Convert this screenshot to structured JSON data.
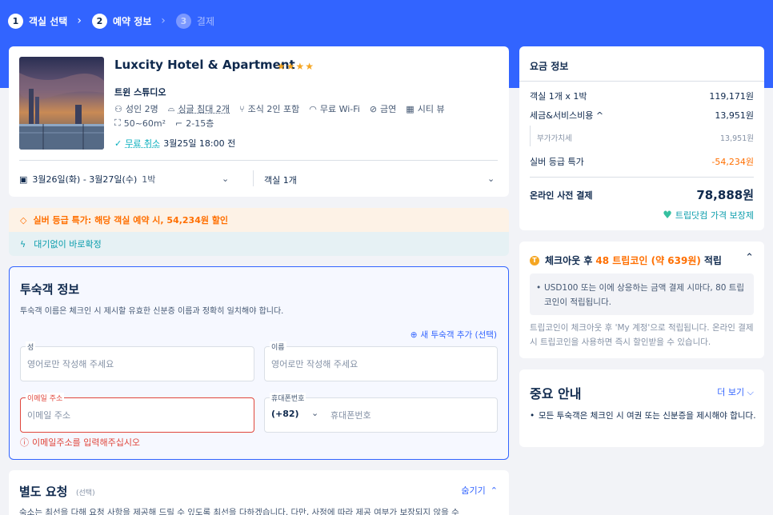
{
  "steps": [
    {
      "num": "1",
      "label": "객실 선택"
    },
    {
      "num": "2",
      "label": "예약 정보"
    },
    {
      "num": "3",
      "label": "결제"
    }
  ],
  "hotel": {
    "name": "Luxcity Hotel & Apartment",
    "stars": "★★★★",
    "room_name": "트윈 스튜디오",
    "amenities_row1": [
      "성인 2명",
      "싱글 침대 2개",
      "조식 2인 포함",
      "무료 Wi-Fi",
      "금연",
      "시티 뷰"
    ],
    "amenities_row2": [
      "50~60m²",
      "2-15층"
    ],
    "cancel_label": "무료 취소",
    "cancel_deadline": "3월25일 18:00 전",
    "dates": "3월26일(화) - 3월27일(수)",
    "nights": "1박",
    "rooms": "객실 1개"
  },
  "promo": {
    "discount_text": "실버 등급 특가: 해당 객실 예약 시, 54,234원 할인",
    "instant_text": "대기없이 바로확정"
  },
  "guest_form": {
    "title": "투숙객 정보",
    "desc": "투숙객 이름은 체크인 시 제시할 유효한 신분증 이름과 정확히 일치해야 합니다.",
    "add_guest": "새 투숙객 추가 (선택)",
    "last_name_label": "성",
    "last_name_placeholder": "영어로만 작성해 주세요",
    "first_name_label": "이름",
    "first_name_placeholder": "영어로만 작성해 주세요",
    "email_label": "이메일 주소",
    "email_placeholder": "이메일 주소",
    "email_error": "이메일주소를 입력해주십시오",
    "phone_label": "휴대폰번호",
    "phone_code": "(+82)",
    "phone_placeholder": "휴대폰번호"
  },
  "special_request": {
    "title": "별도 요청",
    "optional": "(선택)",
    "hide": "숨기기",
    "desc": "숙소는 최선을 다해 요청 사항을 제공해 드릴 수 있도록 최선을 다하겠습니다. 다만, 사정에 따라 제공 여부가 보장되지 않을 수"
  },
  "price": {
    "title": "요금 정보",
    "rows": [
      {
        "label": "객실 1개 x 1박",
        "value": "119,171원"
      },
      {
        "label": "세금&서비스비용 ^",
        "value": "13,951원"
      },
      {
        "label": "부가가치세",
        "value": "13,951원"
      },
      {
        "label": "실버 등급 특가",
        "value": "-54,234원"
      }
    ],
    "total_label": "온라인 사전 결제",
    "total_value": "78,888원",
    "guarantee": "트립닷컴 가격 보장제"
  },
  "coin": {
    "head_prefix": "체크아웃 후",
    "head_amount": "48 트립코인 (약 639원)",
    "head_suffix": "적립",
    "box_text": "USD100 또는 이에 상응하는 금액 결제 시마다, 80 트립코인이 적립됩니다.",
    "note": "트립코인이 체크아웃 후 'My 계정'으로 적립됩니다. 온라인 결제 시 트립코인을 사용하면 즉시 할인받을 수 있습니다."
  },
  "notice": {
    "title": "중요 안내",
    "more": "더 보기 ⌵",
    "text": "모든 투숙객은 체크인 시 여권 또는 신분증을 제시해야 합니다."
  },
  "colors": {
    "brand": "#3264ff",
    "orange": "#ff6f00",
    "teal": "#0b9dac",
    "error": "#e0463c"
  }
}
